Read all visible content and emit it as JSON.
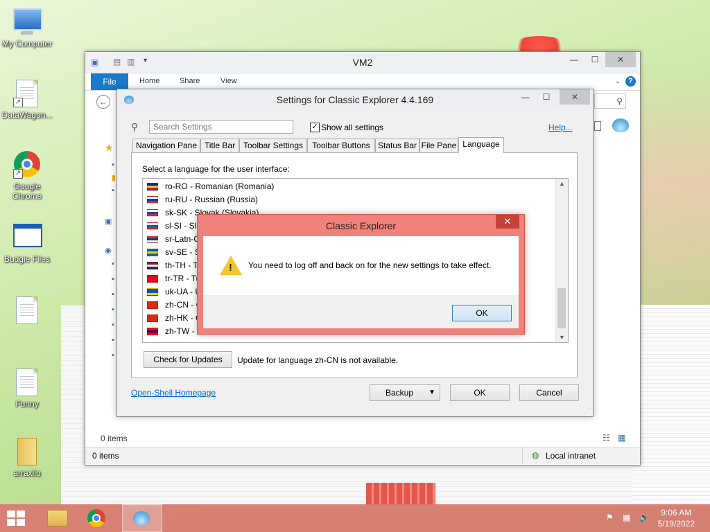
{
  "desktop": {
    "icons": [
      {
        "label": "My Computer",
        "icon": "computer-icon"
      },
      {
        "label": "DataWagon...",
        "icon": "document-shortcut-icon"
      },
      {
        "label": "Google Chrome",
        "icon": "chrome-icon"
      },
      {
        "label": "Budgie Files",
        "icon": "window-icon"
      },
      {
        "label": "",
        "icon": "document-icon"
      },
      {
        "label": "Funny",
        "icon": "document-icon"
      },
      {
        "label": "arraxiio",
        "icon": "folder-icon"
      }
    ]
  },
  "explorer": {
    "title": "VM2",
    "ribbon_tabs": {
      "file": "File",
      "home": "Home",
      "share": "Share",
      "view": "View"
    },
    "items_count": "0 items",
    "status_items": "0 items",
    "zone": "Local intranet"
  },
  "settings": {
    "title": "Settings for Classic Explorer 4.4.169",
    "search_placeholder": "Search Settings",
    "show_all_label": "Show all settings",
    "show_all_checked": true,
    "help_link": "Help...",
    "tabs": [
      "Navigation Pane",
      "Title Bar",
      "Toolbar Settings",
      "Toolbar Buttons",
      "Status Bar",
      "File Pane",
      "Language"
    ],
    "active_tab": "Language",
    "prompt": "Select a language for the user interface:",
    "languages": [
      {
        "text": "ro-RO - Romanian (Romania)",
        "flag": [
          "#002b7f",
          "#fcd116",
          "#ce1126"
        ]
      },
      {
        "text": "ru-RU - Russian (Russia)",
        "flag": [
          "#ffffff",
          "#0039a6",
          "#d52b1e"
        ]
      },
      {
        "text": "sk-SK - Slovak (Slovakia)",
        "flag": [
          "#ffffff",
          "#0b4ea2",
          "#ee1c25"
        ]
      },
      {
        "text": "sl-SI - Slo",
        "flag": [
          "#ffffff",
          "#005da4",
          "#ed1c24"
        ]
      },
      {
        "text": "sr-Latn-C",
        "flag": [
          "#c6363c",
          "#0c4076",
          "#ffffff"
        ]
      },
      {
        "text": "sv-SE - Sv",
        "flag": [
          "#006aa7",
          "#fecc00",
          "#006aa7"
        ]
      },
      {
        "text": "th-TH - T",
        "flag": [
          "#a51931",
          "#f4f5f8",
          "#2d2a4a"
        ]
      },
      {
        "text": "tr-TR - Tu",
        "flag": [
          "#e30a17",
          "#e30a17",
          "#e30a17"
        ]
      },
      {
        "text": "uk-UA - U",
        "flag": [
          "#0057b7",
          "#0057b7",
          "#ffd700"
        ]
      },
      {
        "text": "zh-CN - C",
        "flag": [
          "#de2910",
          "#de2910",
          "#de2910"
        ]
      },
      {
        "text": "zh-HK - C",
        "flag": [
          "#de2910",
          "#de2910",
          "#de2910"
        ]
      },
      {
        "text": "zh-TW - C",
        "flag": [
          "#fe0000",
          "#000095",
          "#fe0000"
        ]
      }
    ],
    "check_updates_button": "Check for Updates",
    "update_status": "Update for language zh-CN is not available.",
    "homepage_link": "Open-Shell Homepage",
    "backup_button": "Backup",
    "ok_button": "OK",
    "cancel_button": "Cancel"
  },
  "message_box": {
    "title": "Classic Explorer",
    "message": "You need to log off and back on for the new settings to take effect.",
    "ok_button": "OK"
  },
  "taskbar": {
    "time": "9:06 AM",
    "date": "5/19/2022"
  },
  "colors": {
    "accent": "#1979ca",
    "message_frame": "#f0827b",
    "taskbar": "#d87870"
  }
}
